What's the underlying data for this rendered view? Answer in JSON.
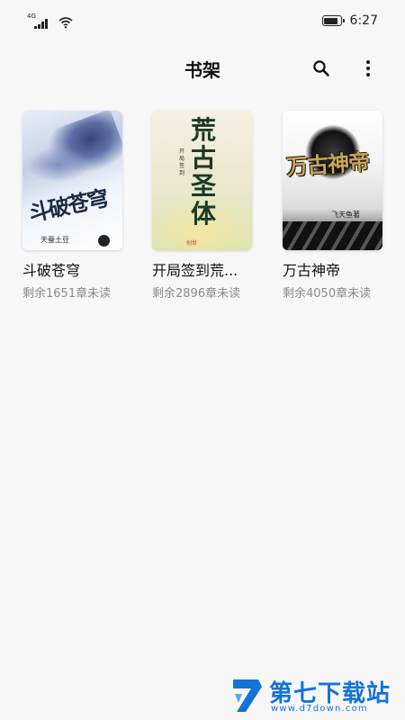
{
  "status_bar": {
    "network": "4G",
    "time": "6:27",
    "battery_level": 0.9
  },
  "header": {
    "title": "书架",
    "icons": [
      "search-icon",
      "more-vertical-icon"
    ]
  },
  "books": [
    {
      "title": "斗破苍穹",
      "progress": "剩余1651章未读",
      "cover": {
        "title": "斗破苍穹",
        "author": "天蚕土豆"
      }
    },
    {
      "title": "开局签到荒...",
      "progress": "剩余2896章未读",
      "cover": {
        "title": "荒古圣体",
        "side_text": "开局签到",
        "publisher": "创世"
      }
    },
    {
      "title": "万古神帝",
      "progress": "剩余4050章未读",
      "cover": {
        "title": "万古神帝",
        "author": "飞天鱼著"
      }
    }
  ],
  "watermark": {
    "brand": "第七下载站",
    "url": "www.d7down.com",
    "color": "#1273d8"
  }
}
